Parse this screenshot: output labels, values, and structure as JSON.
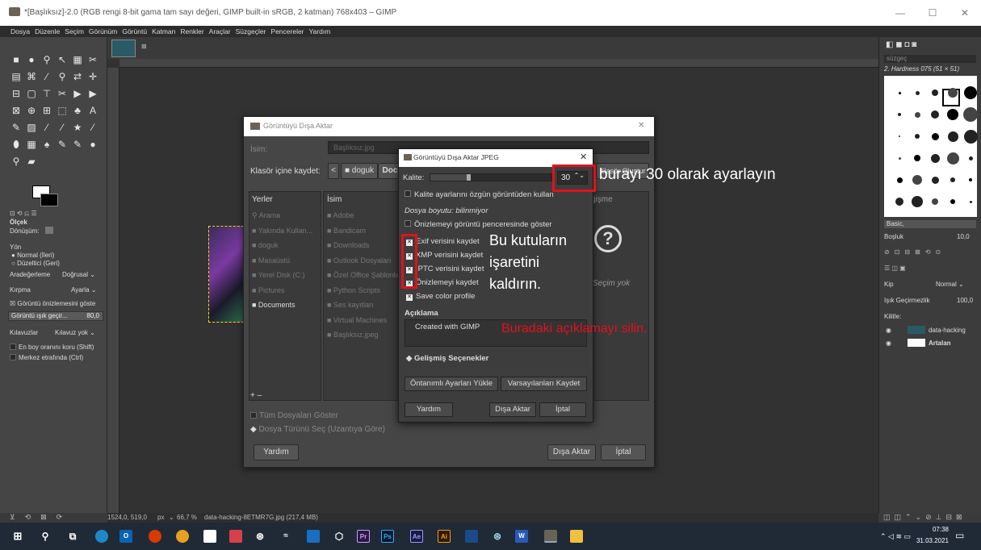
{
  "window": {
    "title": "*[Başlıksız]-2.0 (RGB rengi 8-bit gama tam sayı değeri, GIMP built-in sRGB, 2 katman) 768x403 – GIMP",
    "min": "—",
    "max": "☐",
    "close": "✕"
  },
  "menu": [
    "Dosya",
    "Düzenle",
    "Seçim",
    "Görünüm",
    "Görüntü",
    "Katman",
    "Renkler",
    "Araçlar",
    "Süzgeçler",
    "Pencereler",
    "Yardım"
  ],
  "toolbox": {
    "tool_glyphs": [
      "■",
      "●",
      "⚲",
      "↖",
      "▦",
      "✂",
      "▤",
      "⌘",
      "⁄",
      "⚲",
      "⇄",
      "✛",
      "⊟",
      "▢",
      "⊤",
      "✂",
      "▶",
      "▶",
      "⊠",
      "⊕",
      "⊞",
      "⬚",
      "♣",
      "A",
      "✎",
      "▨",
      "⁄",
      "⁄",
      "★",
      "⁄",
      "⬮",
      "▦",
      "♠",
      "✎",
      "✎",
      "●",
      "⚲",
      "▰"
    ],
    "options_title": "Ölçek",
    "transform_label": "Dönüşüm:",
    "direction_label": "Yön",
    "dir_normal": "Normal (İleri)",
    "dir_reverse": "Düzeltici (Geri)",
    "interp_label": "Aradeğerleme",
    "interp_value": "Doğrusal",
    "clip_label": "Kırpma",
    "clip_value": "Ayarla",
    "preview_check": "Görüntü önizlemesini göste",
    "opacity_label": "Görüntü ışık geçir...",
    "opacity_value": "80,0",
    "guides_label": "Kılavuzlar",
    "guides_value": "Kılavuz yok",
    "keep_aspect": "En boy oranını koru (Shift)",
    "center": "Merkez etrafında (Ctrl)"
  },
  "statusbar": {
    "coords": "1524,0, 519,0",
    "unit": "px",
    "zoom": "66,7 %",
    "file": "data-hacking-8ETMR7G.jpg (217,4 MB)"
  },
  "right_panel": {
    "filter": "süzgeç",
    "brush_name": "2. Hardness 075 (51 × 51)",
    "preset": "Basic,",
    "spacing_label": "Boşluk",
    "spacing_value": "10,0",
    "mode_label": "Kip",
    "mode_value": "Normal",
    "opacity_label": "Işık Geçirmezlik",
    "opacity_value": "100,0",
    "lock_label": "Kilitle:",
    "layers": [
      "data-hacking",
      "Artalan"
    ]
  },
  "export_dialog": {
    "title": "Görüntüyü Dışa Aktar",
    "name_label": "İsim:",
    "name_value": "Başlıksız.jpg",
    "folder_label": "Klasör içine kaydet:",
    "path_items": [
      "doguk",
      "Doc"
    ],
    "create_folder": "Klasör Oluştur",
    "col_places": "Yerler",
    "col_name": "İsim",
    "col_modified": "ğişme",
    "places": [
      "Arama",
      "Yakında Kullan...",
      "doguk",
      "Masaüstü",
      "Yerel Disk (C:)",
      "Pictures",
      "Documents"
    ],
    "files": [
      "Adobe",
      "Bandicam",
      "Downloads",
      "Outlook Dosyaları",
      "Özel Office Şablonları",
      "Python Scripts",
      "Ses kayıtları",
      "Virtual Machines",
      "Başlıksız.jpeg"
    ],
    "no_selection": "Seçim yok",
    "add_remove": "+ –",
    "show_all": "Tüm Dosyaları Göster",
    "select_type": "Dosya Türünü Seç (Uzantıya Göre)",
    "help": "Yardım",
    "export": "Dışa Aktar",
    "cancel": "İptal"
  },
  "jpeg_dialog": {
    "title": "Görüntüyü Dışa Aktar JPEG",
    "quality_label": "Kalite:",
    "quality_value": "30",
    "quality_fraction": 0.3,
    "use_original": "Kalite ayarlarını özgün görüntüden kullan",
    "file_size": "Dosya boyutu: bilinmiyor",
    "preview": "Önizlemeyi görüntü penceresinde göster",
    "exif": "Exif verisini kaydet",
    "xmp": "XMP verisini kaydet",
    "iptc": "IPTC verisini kaydet",
    "thumbnail": "Önizlemeyi kaydet",
    "color_profile": "Save color profile",
    "comment_label": "Açıklama",
    "comment_value": "Created with GIMP",
    "advanced": "Gelişmiş Seçenekler",
    "load_defaults": "Öntanımlı Ayarları Yükle",
    "save_defaults": "Varsayılanları Kaydet",
    "help": "Yardım",
    "export": "Dışa Aktar",
    "cancel": "İptal"
  },
  "annotations": {
    "quality": "burayı 30 olarak ayarlayın",
    "checkboxes_1": "Bu kutuların",
    "checkboxes_2": "işaretini",
    "checkboxes_3": "kaldırın.",
    "comment": "Buradaki açıklamayı silin."
  },
  "taskbar": {
    "time": "07:38",
    "date": "31.03.2021"
  },
  "colors": {
    "annotation_red": "#e0121b",
    "gimp_bg": "#3a3a3a"
  }
}
